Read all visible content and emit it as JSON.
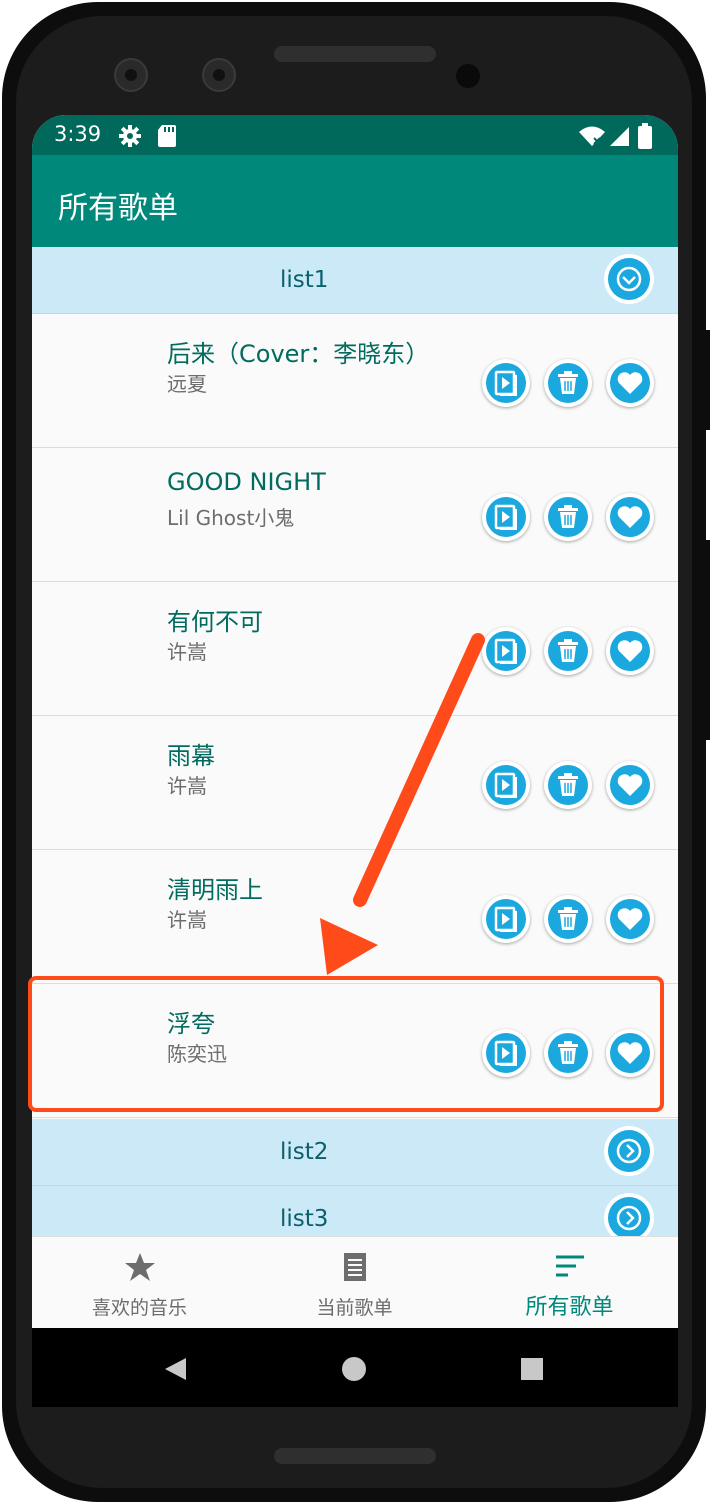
{
  "status_bar": {
    "time": "3:39"
  },
  "app_bar": {
    "title": "所有歌单"
  },
  "groups": [
    {
      "label": "list1",
      "expanded": true
    },
    {
      "label": "list2",
      "expanded": false
    },
    {
      "label": "list3",
      "expanded": false
    }
  ],
  "songs": [
    {
      "title": "后来（Cover：李晓东）",
      "artist": "远夏"
    },
    {
      "title": "GOOD NIGHT",
      "artist": "Lil Ghost小鬼"
    },
    {
      "title": "有何不可",
      "artist": "许嵩"
    },
    {
      "title": "雨幕",
      "artist": "许嵩"
    },
    {
      "title": "清明雨上",
      "artist": "许嵩"
    },
    {
      "title": "浮夸",
      "artist": "陈奕迅"
    }
  ],
  "song_actions": [
    "play-icon",
    "trash-icon",
    "heart-icon"
  ],
  "bottom_nav": {
    "tabs": [
      {
        "label": "喜欢的音乐",
        "icon": "star-icon"
      },
      {
        "label": "当前歌单",
        "icon": "list-icon"
      },
      {
        "label": "所有歌单",
        "icon": "sort-icon",
        "active": true
      }
    ]
  },
  "colors": {
    "status_bar": "#00695c",
    "app_bar": "#00897b",
    "group_header": "#cce9f7",
    "accent_blue": "#1aa8df",
    "song_title": "#006b5e",
    "annotation": "#ff4a1a"
  }
}
